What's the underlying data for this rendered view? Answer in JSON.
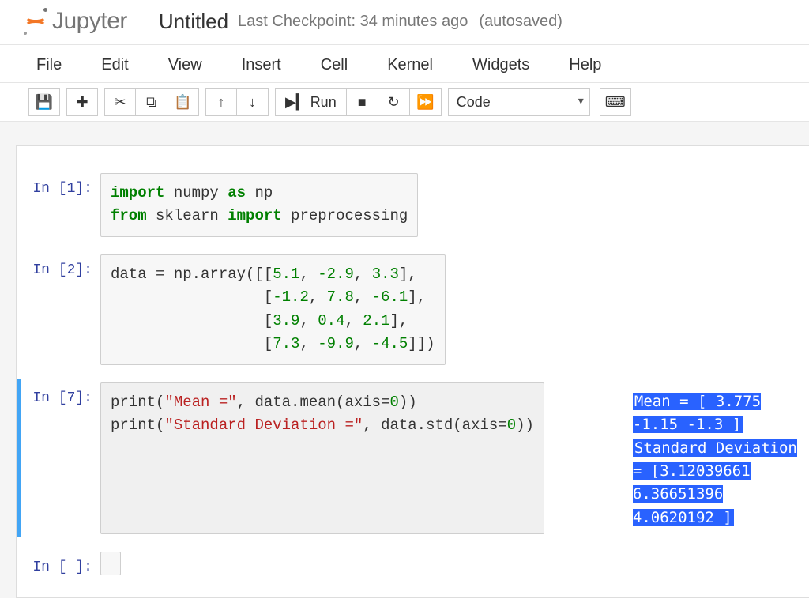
{
  "header": {
    "logo_text": "Jupyter",
    "title": "Untitled",
    "checkpoint": "Last Checkpoint: 34 minutes ago",
    "autosaved": "(autosaved)"
  },
  "menu": {
    "items": [
      "File",
      "Edit",
      "View",
      "Insert",
      "Cell",
      "Kernel",
      "Widgets",
      "Help"
    ]
  },
  "toolbar": {
    "save_icon": "💾",
    "add_icon": "✚",
    "cut_icon": "✂",
    "copy_icon": "⧉",
    "paste_icon": "📋",
    "up_icon": "↑",
    "down_icon": "↓",
    "run_icon": "▶▎",
    "run_label": "Run",
    "stop_icon": "■",
    "restart_icon": "↻",
    "ff_icon": "⏩",
    "celltype": "Code",
    "keyboard_icon": "⌨"
  },
  "cells": [
    {
      "prompt": "In [1]:",
      "code_html": "<span class='k-green'>import</span> numpy <span class='k-green'>as</span> np\n<span class='k-green'>from</span> sklearn <span class='k-green'>import</span> preprocessing"
    },
    {
      "prompt": "In [2]:",
      "code_html": "data = np.array([[<span class='k-num'>5.1</span>, <span class='k-num'>-2.9</span>, <span class='k-num'>3.3</span>],\n                 [<span class='k-num'>-1.2</span>, <span class='k-num'>7.8</span>, <span class='k-num'>-6.1</span>],\n                 [<span class='k-num'>3.9</span>, <span class='k-num'>0.4</span>, <span class='k-num'>2.1</span>],\n                 [<span class='k-num'>7.3</span>, <span class='k-num'>-9.9</span>, <span class='k-num'>-4.5</span>]])"
    },
    {
      "prompt": "In [7]:",
      "selected": true,
      "code_html": "print(<span class='k-str'>\"Mean =\"</span>, data.mean(axis=<span class='k-num'>0</span>))\nprint(<span class='k-str'>\"Standard Deviation =\"</span>, data.std(axis=<span class='k-num'>0</span>))",
      "output_lines": [
        "Mean = [ 3.775 -1.15  -1.3  ]",
        "Standard Deviation = [3.12039661 6.36651396 4.0620192 ]"
      ]
    },
    {
      "prompt": "In [ ]:",
      "code_html": ""
    }
  ]
}
